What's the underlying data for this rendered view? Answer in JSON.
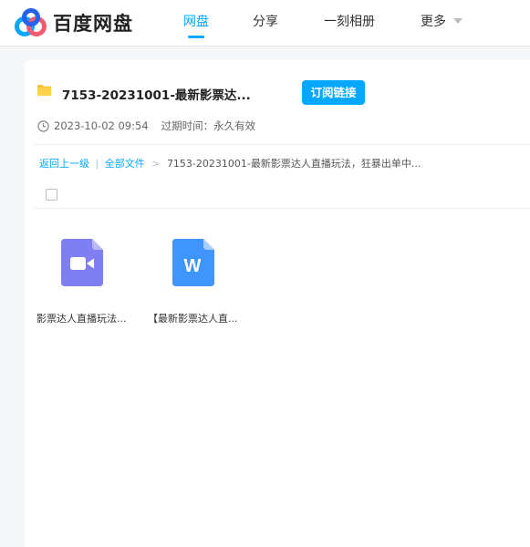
{
  "header": {
    "logo_text": "百度网盘",
    "nav": [
      {
        "label": "网盘",
        "active": true
      },
      {
        "label": "分享",
        "active": false
      },
      {
        "label": "一刻相册",
        "active": false
      },
      {
        "label": "更多",
        "active": false
      }
    ]
  },
  "share": {
    "title": "7153-20231001-最新影票达...",
    "subscribe_label": "订阅链接",
    "date": "2023-10-02 09:54",
    "expire_label": "过期时间：",
    "expire_value": "永久有效"
  },
  "breadcrumb": {
    "back": "返回上一级",
    "separator": "|",
    "all_files": "全部文件",
    "arrow": ">",
    "current": "7153-20231001-最新影票达人直播玩法，狂暴出单中..."
  },
  "files": [
    {
      "name": "影票达人直播玩法...",
      "type": "video",
      "icon": "video-file-icon"
    },
    {
      "name": "【最新影票达人直...",
      "type": "word",
      "icon": "word-file-icon"
    }
  ],
  "colors": {
    "accent": "#06a7ff",
    "video_icon": "#7f7ff2",
    "word_icon": "#3f95fb"
  }
}
